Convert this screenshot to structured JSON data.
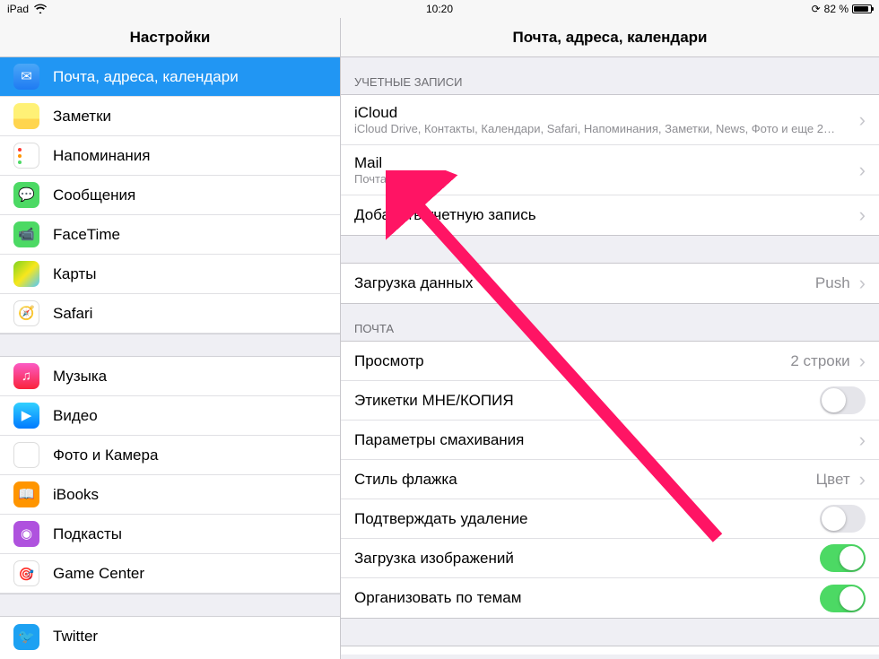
{
  "status": {
    "device": "iPad",
    "time": "10:20",
    "battery_text": "82 %"
  },
  "sidebar": {
    "title": "Настройки",
    "items": [
      {
        "label": "Почта, адреса, календари",
        "icon": "mail"
      },
      {
        "label": "Заметки",
        "icon": "notes"
      },
      {
        "label": "Напоминания",
        "icon": "reminders"
      },
      {
        "label": "Сообщения",
        "icon": "messages"
      },
      {
        "label": "FaceTime",
        "icon": "facetime"
      },
      {
        "label": "Карты",
        "icon": "maps"
      },
      {
        "label": "Safari",
        "icon": "safari"
      },
      {
        "label": "Музыка",
        "icon": "music"
      },
      {
        "label": "Видео",
        "icon": "video"
      },
      {
        "label": "Фото и Камера",
        "icon": "photos"
      },
      {
        "label": "iBooks",
        "icon": "ibooks"
      },
      {
        "label": "Подкасты",
        "icon": "podcasts"
      },
      {
        "label": "Game Center",
        "icon": "gamecenter"
      },
      {
        "label": "Twitter",
        "icon": "twitter"
      }
    ]
  },
  "detail": {
    "title": "Почта, адреса, календари",
    "sections": {
      "accounts_header": "УЧЕТНЫЕ ЗАПИСИ",
      "accounts": [
        {
          "title": "iCloud",
          "sub": "iCloud Drive, Контакты, Календари, Safari, Напоминания, Заметки, News, Фото и еще 2…"
        },
        {
          "title": "Mail",
          "sub": "Почта"
        }
      ],
      "add_account": "Добавить учетную запись",
      "fetch": {
        "label": "Загрузка данных",
        "value": "Push"
      },
      "mail_header": "ПОЧТА",
      "mail": {
        "preview": {
          "label": "Просмотр",
          "value": "2 строки"
        },
        "tome_cc": {
          "label": "Этикетки МНЕ/КОПИЯ",
          "on": false
        },
        "swipe": {
          "label": "Параметры смахивания"
        },
        "flag": {
          "label": "Стиль флажка",
          "value": "Цвет"
        },
        "confirm_delete": {
          "label": "Подтверждать удаление",
          "on": false
        },
        "load_images": {
          "label": "Загрузка изображений",
          "on": true
        },
        "organize_thread": {
          "label": "Организовать по темам",
          "on": true
        }
      }
    }
  }
}
